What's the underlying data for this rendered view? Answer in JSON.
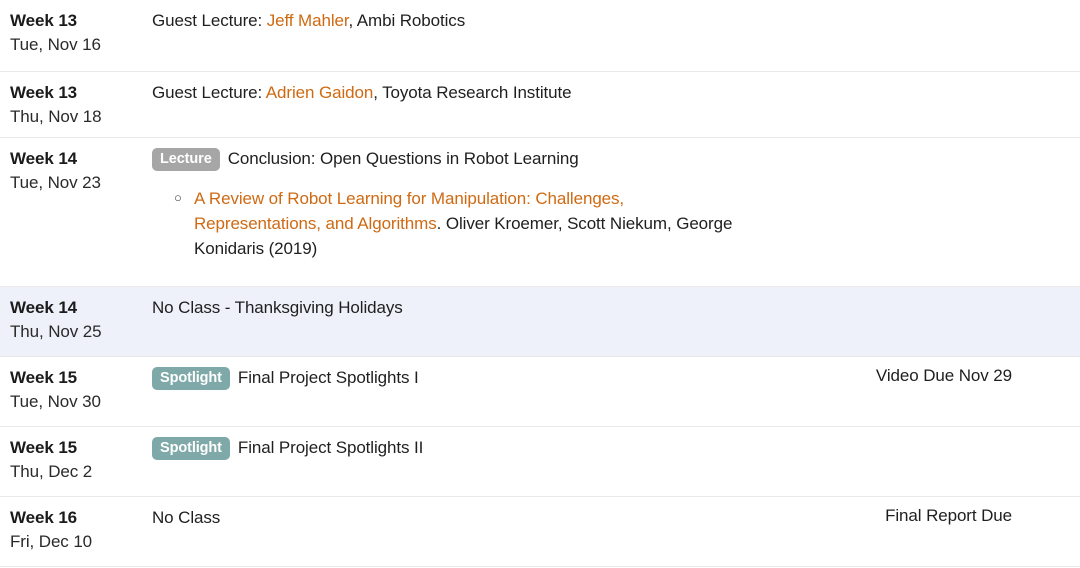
{
  "colors": {
    "link": "#cf6a13",
    "badge_lecture": "#a6a6a6",
    "badge_spotlight": "#7fa9a9",
    "row_highlight": "#eef1fa",
    "divider": "#e9e9e9",
    "text": "#1f1f1f"
  },
  "labels": {
    "lecture_badge": "Lecture",
    "spotlight_badge": "Spotlight",
    "bullet_glyph": "○"
  },
  "rows": [
    {
      "week": "Week 13",
      "day": "Tue, Nov 16",
      "prefix": "Guest Lecture: ",
      "link": "Jeff Mahler",
      "suffix": ", Ambi Robotics",
      "due": ""
    },
    {
      "week": "Week 13",
      "day": "Thu, Nov 18",
      "prefix": "Guest Lecture: ",
      "link": "Adrien Gaidon",
      "suffix": ", Toyota Research Institute",
      "due": ""
    },
    {
      "week": "Week 14",
      "day": "Tue, Nov 23",
      "badge": "Lecture",
      "title": "Conclusion: Open Questions in Robot Learning",
      "reading_link": "A Review of Robot Learning for Manipulation: Challenges, Representations, and Algorithms",
      "reading_rest": ". Oliver Kroemer, Scott Niekum, George Konidaris (2019)",
      "due": ""
    },
    {
      "week": "Week 14",
      "day": "Thu, Nov 25",
      "text": "No Class - Thanksgiving Holidays",
      "due": "",
      "highlight": true
    },
    {
      "week": "Week 15",
      "day": "Tue, Nov 30",
      "badge": "Spotlight",
      "title": "Final Project Spotlights I",
      "due": "Video Due Nov 29"
    },
    {
      "week": "Week 15",
      "day": "Thu, Dec 2",
      "badge": "Spotlight",
      "title": "Final Project Spotlights II",
      "due": ""
    },
    {
      "week": "Week 16",
      "day": "Fri, Dec 10",
      "text": "No Class",
      "due": "Final Report Due"
    }
  ]
}
